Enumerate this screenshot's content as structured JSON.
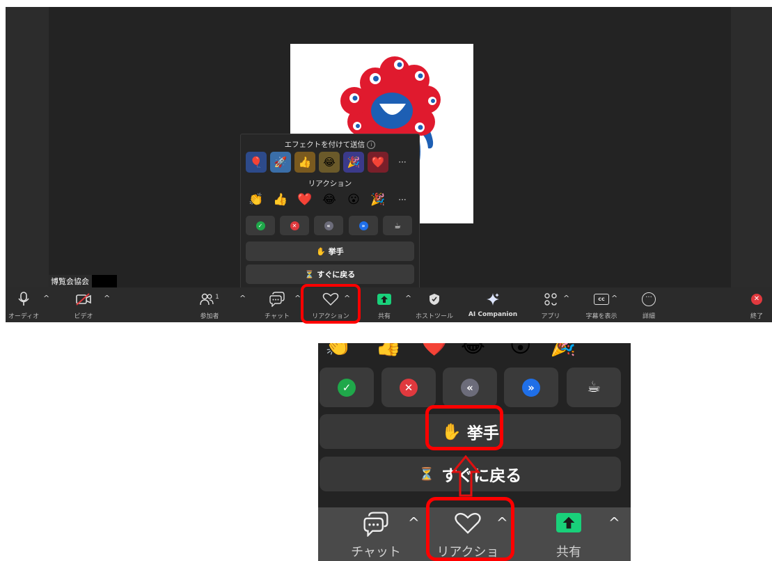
{
  "participant_name": "博覧会協会",
  "popup": {
    "effects_title": "エフェクトを付けて送信",
    "effects": [
      "🎈",
      "🚀",
      "👍",
      "😂",
      "🎉",
      "❤️"
    ],
    "more": "···",
    "reactions_title": "リアクション",
    "reactions": [
      "👏",
      "👍",
      "❤️",
      "😂",
      "😮",
      "🎉"
    ],
    "raise_hand": "✋ 挙手",
    "be_right_back": "⏳ すぐに戻る"
  },
  "toolbar": {
    "audio": "オーディオ",
    "video": "ビデオ",
    "participants": "参加者",
    "participants_count": "1",
    "chat": "チャット",
    "reactions": "リアクション",
    "share": "共有",
    "host_tools": "ホストツール",
    "ai_companion": "AI Companion",
    "apps": "アプリ",
    "captions": "字幕を表示",
    "more": "詳細",
    "end": "終了"
  },
  "zoom": {
    "raise_hand": "挙手",
    "be_right_back": "すぐに戻る",
    "chat": "チャット",
    "reactions": "リアクション",
    "share": "共有"
  },
  "colors": {
    "highlight": "#ff0000",
    "check": "#1fa84a",
    "cross": "#e0393e",
    "slower": "#6c6c7a",
    "faster": "#1f6fe8",
    "share_green": "#19d07a"
  }
}
